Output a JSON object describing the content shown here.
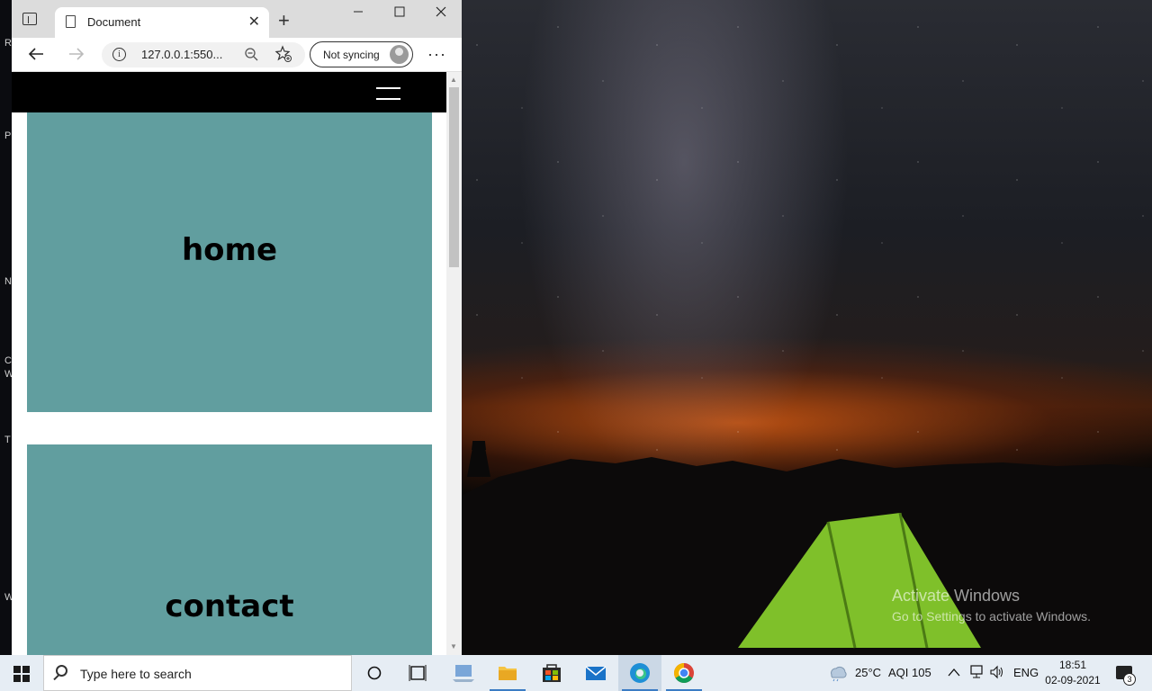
{
  "browser": {
    "tab_title": "Document",
    "url": "127.0.0.1:550...",
    "sync_label": "Not syncing",
    "tab_close_glyph": "✕",
    "new_tab_glyph": "+",
    "more_glyph": "···"
  },
  "page": {
    "sections": [
      {
        "label": "home"
      },
      {
        "label": "contact"
      }
    ],
    "section_color": "#619e9f",
    "navbar_color": "#000000"
  },
  "desktop": {
    "activate_title": "Activate Windows",
    "activate_subtitle": "Go to Settings to activate Windows.",
    "edge_letters": [
      "R",
      "P",
      "N",
      "C",
      "W",
      "T",
      "W"
    ]
  },
  "taskbar": {
    "search_placeholder": "Type here to search",
    "weather": "25°C",
    "aqi": "AQI 105",
    "language": "ENG",
    "time": "18:51",
    "date": "02-09-2021",
    "notification_count": "3"
  }
}
